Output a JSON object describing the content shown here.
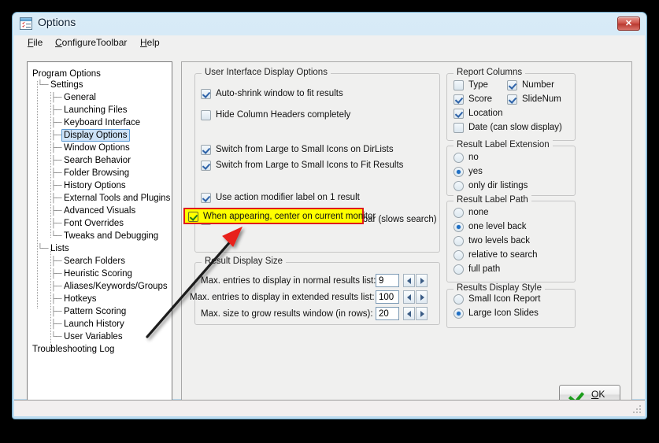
{
  "window": {
    "title": "Options",
    "icon": "options-window-icon",
    "close_label": "✕"
  },
  "menubar": [
    {
      "label": "File",
      "accel": "F"
    },
    {
      "label": "ConfigureToolbar",
      "accel": "C"
    },
    {
      "label": "Help",
      "accel": "H"
    }
  ],
  "tree": {
    "selected": "Display Options",
    "items": [
      {
        "label": "Program Options",
        "level": 0
      },
      {
        "label": "Settings",
        "level": 1
      },
      {
        "label": "General",
        "level": 2
      },
      {
        "label": "Launching Files",
        "level": 2
      },
      {
        "label": "Keyboard Interface",
        "level": 2
      },
      {
        "label": "Display Options",
        "level": 2,
        "selected": true
      },
      {
        "label": "Window Options",
        "level": 2
      },
      {
        "label": "Search Behavior",
        "level": 2
      },
      {
        "label": "Folder Browsing",
        "level": 2
      },
      {
        "label": "History Options",
        "level": 2
      },
      {
        "label": "External Tools and Plugins",
        "level": 2
      },
      {
        "label": "Advanced Visuals",
        "level": 2
      },
      {
        "label": "Font Overrides",
        "level": 2
      },
      {
        "label": "Tweaks and Debugging",
        "level": 2
      },
      {
        "label": "Lists",
        "level": 1
      },
      {
        "label": "Search Folders",
        "level": 2
      },
      {
        "label": "Heuristic Scoring",
        "level": 2
      },
      {
        "label": "Aliases/Keywords/Groups",
        "level": 2
      },
      {
        "label": "Hotkeys",
        "level": 2
      },
      {
        "label": "Pattern Scoring",
        "level": 2
      },
      {
        "label": "Launch History",
        "level": 2
      },
      {
        "label": "User Variables",
        "level": 2
      },
      {
        "label": "Troubleshooting Log",
        "level": 0
      }
    ]
  },
  "ui_display_options": {
    "title": "User Interface Display Options",
    "checkboxes": [
      {
        "label": "Auto-shrink window to fit results",
        "checked": true
      },
      {
        "label": "Hide Column Headers completely",
        "checked": false
      },
      {
        "label": "Switch from Large to Small Icons on DirLists",
        "checked": true
      },
      {
        "label": "Switch from Large to Small Icons to Fit Results",
        "checked": true
      },
      {
        "label": "Use action modifier label on 1 result",
        "checked": true
      },
      {
        "label": "Show search subdir details in status bar (slows search)",
        "checked": false
      }
    ],
    "highlighted": {
      "label": "When appearing, center on current monitor",
      "checked": true,
      "highlight_bg": "#ffff00",
      "highlight_border": "#e01b1b"
    }
  },
  "result_display_size": {
    "title": "Result Display Size",
    "rows": [
      {
        "label": "Max. entries to display in normal results list:",
        "value": "9"
      },
      {
        "label": "Max. entries to display in extended results list:",
        "value": "100"
      },
      {
        "label": "Max. size to grow results window (in rows):",
        "value": "20"
      }
    ]
  },
  "report_columns": {
    "title": "Report Columns",
    "items": [
      {
        "label": "Type",
        "checked": false
      },
      {
        "label": "Number",
        "checked": true
      },
      {
        "label": "Score",
        "checked": true
      },
      {
        "label": "SlideNum",
        "checked": true
      },
      {
        "label": "Location",
        "checked": true
      },
      {
        "label": "Date (can slow display)",
        "checked": false
      }
    ]
  },
  "result_label_extension": {
    "title": "Result Label Extension",
    "options": [
      {
        "label": "no",
        "selected": false
      },
      {
        "label": "yes",
        "selected": true
      },
      {
        "label": "only dir listings",
        "selected": false
      }
    ]
  },
  "result_label_path": {
    "title": "Result Label Path",
    "options": [
      {
        "label": "none",
        "selected": false
      },
      {
        "label": "one level back",
        "selected": true
      },
      {
        "label": "two levels back",
        "selected": false
      },
      {
        "label": "relative to search",
        "selected": false
      },
      {
        "label": "full path",
        "selected": false
      }
    ]
  },
  "results_display_style": {
    "title": "Results Display Style",
    "options": [
      {
        "label": "Small Icon Report",
        "selected": false
      },
      {
        "label": "Large Icon Slides",
        "selected": true
      }
    ]
  },
  "footer": {
    "ok_label": "OK",
    "ok_accel": "O"
  },
  "annotation": {
    "type": "arrow",
    "color": "#e01b1b",
    "line_color": "#1a1a1a",
    "points_to": "When appearing, center on current monitor"
  }
}
